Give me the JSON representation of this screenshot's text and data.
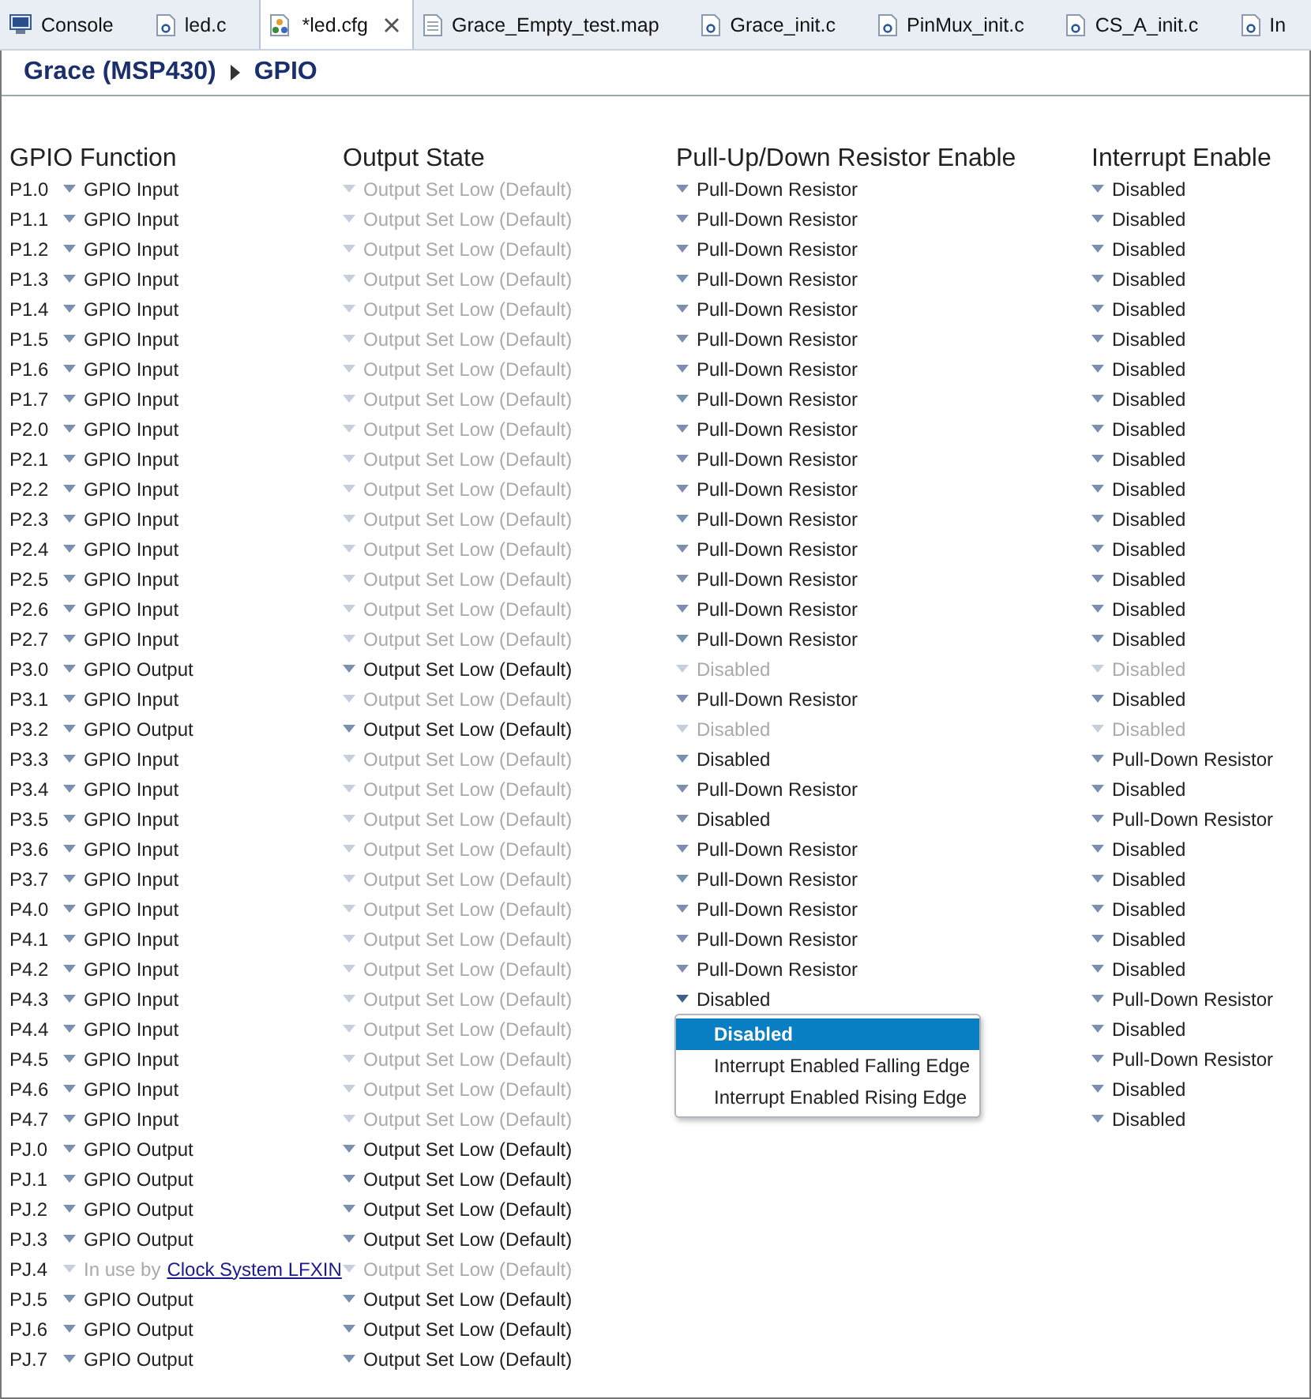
{
  "tabs": [
    {
      "label": "Console",
      "kind": "console",
      "selected": false,
      "closable": false
    },
    {
      "label": "led.c",
      "kind": "c",
      "selected": false,
      "closable": false
    },
    {
      "label": "*led.cfg",
      "kind": "cfg",
      "selected": true,
      "closable": true
    },
    {
      "label": "Grace_Empty_test.map",
      "kind": "file",
      "selected": false,
      "closable": false
    },
    {
      "label": "Grace_init.c",
      "kind": "c",
      "selected": false,
      "closable": false
    },
    {
      "label": "PinMux_init.c",
      "kind": "c",
      "selected": false,
      "closable": false
    },
    {
      "label": "CS_A_init.c",
      "kind": "c",
      "selected": false,
      "closable": false
    },
    {
      "label": "In",
      "kind": "c",
      "selected": false,
      "closable": false
    }
  ],
  "breadcrumb": [
    "Grace (MSP430)",
    "GPIO"
  ],
  "columns": [
    "GPIO Function",
    "Output State",
    "Pull-Up/Down Resistor Enable",
    "Interrupt Enable"
  ],
  "rows": [
    {
      "pin": "P1.0",
      "function": {
        "text": "GPIO Input",
        "disabled": false
      },
      "output": {
        "text": "Output Set Low (Default)",
        "disabled": true
      },
      "pull": {
        "text": "Pull-Down Resistor",
        "disabled": false
      },
      "interrupt": {
        "text": "Disabled",
        "disabled": false
      }
    },
    {
      "pin": "P1.1",
      "function": {
        "text": "GPIO Input",
        "disabled": false
      },
      "output": {
        "text": "Output Set Low (Default)",
        "disabled": true
      },
      "pull": {
        "text": "Pull-Down Resistor",
        "disabled": false
      },
      "interrupt": {
        "text": "Disabled",
        "disabled": false
      }
    },
    {
      "pin": "P1.2",
      "function": {
        "text": "GPIO Input",
        "disabled": false
      },
      "output": {
        "text": "Output Set Low (Default)",
        "disabled": true
      },
      "pull": {
        "text": "Pull-Down Resistor",
        "disabled": false
      },
      "interrupt": {
        "text": "Disabled",
        "disabled": false
      }
    },
    {
      "pin": "P1.3",
      "function": {
        "text": "GPIO Input",
        "disabled": false
      },
      "output": {
        "text": "Output Set Low (Default)",
        "disabled": true
      },
      "pull": {
        "text": "Pull-Down Resistor",
        "disabled": false
      },
      "interrupt": {
        "text": "Disabled",
        "disabled": false
      }
    },
    {
      "pin": "P1.4",
      "function": {
        "text": "GPIO Input",
        "disabled": false
      },
      "output": {
        "text": "Output Set Low (Default)",
        "disabled": true
      },
      "pull": {
        "text": "Pull-Down Resistor",
        "disabled": false
      },
      "interrupt": {
        "text": "Disabled",
        "disabled": false
      }
    },
    {
      "pin": "P1.5",
      "function": {
        "text": "GPIO Input",
        "disabled": false
      },
      "output": {
        "text": "Output Set Low (Default)",
        "disabled": true
      },
      "pull": {
        "text": "Pull-Down Resistor",
        "disabled": false
      },
      "interrupt": {
        "text": "Disabled",
        "disabled": false
      }
    },
    {
      "pin": "P1.6",
      "function": {
        "text": "GPIO Input",
        "disabled": false
      },
      "output": {
        "text": "Output Set Low (Default)",
        "disabled": true
      },
      "pull": {
        "text": "Pull-Down Resistor",
        "disabled": false
      },
      "interrupt": {
        "text": "Disabled",
        "disabled": false
      }
    },
    {
      "pin": "P1.7",
      "function": {
        "text": "GPIO Input",
        "disabled": false
      },
      "output": {
        "text": "Output Set Low (Default)",
        "disabled": true
      },
      "pull": {
        "text": "Pull-Down Resistor",
        "disabled": false
      },
      "interrupt": {
        "text": "Disabled",
        "disabled": false
      }
    },
    {
      "pin": "P2.0",
      "function": {
        "text": "GPIO Input",
        "disabled": false
      },
      "output": {
        "text": "Output Set Low (Default)",
        "disabled": true
      },
      "pull": {
        "text": "Pull-Down Resistor",
        "disabled": false
      },
      "interrupt": {
        "text": "Disabled",
        "disabled": false
      }
    },
    {
      "pin": "P2.1",
      "function": {
        "text": "GPIO Input",
        "disabled": false
      },
      "output": {
        "text": "Output Set Low (Default)",
        "disabled": true
      },
      "pull": {
        "text": "Pull-Down Resistor",
        "disabled": false
      },
      "interrupt": {
        "text": "Disabled",
        "disabled": false
      }
    },
    {
      "pin": "P2.2",
      "function": {
        "text": "GPIO Input",
        "disabled": false
      },
      "output": {
        "text": "Output Set Low (Default)",
        "disabled": true
      },
      "pull": {
        "text": "Pull-Down Resistor",
        "disabled": false
      },
      "interrupt": {
        "text": "Disabled",
        "disabled": false
      }
    },
    {
      "pin": "P2.3",
      "function": {
        "text": "GPIO Input",
        "disabled": false
      },
      "output": {
        "text": "Output Set Low (Default)",
        "disabled": true
      },
      "pull": {
        "text": "Pull-Down Resistor",
        "disabled": false
      },
      "interrupt": {
        "text": "Disabled",
        "disabled": false
      }
    },
    {
      "pin": "P2.4",
      "function": {
        "text": "GPIO Input",
        "disabled": false
      },
      "output": {
        "text": "Output Set Low (Default)",
        "disabled": true
      },
      "pull": {
        "text": "Pull-Down Resistor",
        "disabled": false
      },
      "interrupt": {
        "text": "Disabled",
        "disabled": false
      }
    },
    {
      "pin": "P2.5",
      "function": {
        "text": "GPIO Input",
        "disabled": false
      },
      "output": {
        "text": "Output Set Low (Default)",
        "disabled": true
      },
      "pull": {
        "text": "Pull-Down Resistor",
        "disabled": false
      },
      "interrupt": {
        "text": "Disabled",
        "disabled": false
      }
    },
    {
      "pin": "P2.6",
      "function": {
        "text": "GPIO Input",
        "disabled": false
      },
      "output": {
        "text": "Output Set Low (Default)",
        "disabled": true
      },
      "pull": {
        "text": "Pull-Down Resistor",
        "disabled": false
      },
      "interrupt": {
        "text": "Disabled",
        "disabled": false
      }
    },
    {
      "pin": "P2.7",
      "function": {
        "text": "GPIO Input",
        "disabled": false
      },
      "output": {
        "text": "Output Set Low (Default)",
        "disabled": true
      },
      "pull": {
        "text": "Pull-Down Resistor",
        "disabled": false
      },
      "interrupt": {
        "text": "Disabled",
        "disabled": false
      }
    },
    {
      "pin": "P3.0",
      "function": {
        "text": "GPIO Output",
        "disabled": false
      },
      "output": {
        "text": "Output Set Low (Default)",
        "disabled": false
      },
      "pull": {
        "text": "Disabled",
        "disabled": true
      },
      "interrupt": {
        "text": "Disabled",
        "disabled": true
      }
    },
    {
      "pin": "P3.1",
      "function": {
        "text": "GPIO Input",
        "disabled": false
      },
      "output": {
        "text": "Output Set Low (Default)",
        "disabled": true
      },
      "pull": {
        "text": "Pull-Down Resistor",
        "disabled": false
      },
      "interrupt": {
        "text": "Disabled",
        "disabled": false
      }
    },
    {
      "pin": "P3.2",
      "function": {
        "text": "GPIO Output",
        "disabled": false
      },
      "output": {
        "text": "Output Set Low (Default)",
        "disabled": false
      },
      "pull": {
        "text": "Disabled",
        "disabled": true
      },
      "interrupt": {
        "text": "Disabled",
        "disabled": true
      }
    },
    {
      "pin": "P3.3",
      "function": {
        "text": "GPIO Input",
        "disabled": false
      },
      "output": {
        "text": "Output Set Low (Default)",
        "disabled": true
      },
      "pull": {
        "text": "Disabled",
        "disabled": false
      },
      "interrupt": {
        "text": "Pull-Down Resistor",
        "disabled": false
      }
    },
    {
      "pin": "P3.4",
      "function": {
        "text": "GPIO Input",
        "disabled": false
      },
      "output": {
        "text": "Output Set Low (Default)",
        "disabled": true
      },
      "pull": {
        "text": "Pull-Down Resistor",
        "disabled": false
      },
      "interrupt": {
        "text": "Disabled",
        "disabled": false
      }
    },
    {
      "pin": "P3.5",
      "function": {
        "text": "GPIO Input",
        "disabled": false
      },
      "output": {
        "text": "Output Set Low (Default)",
        "disabled": true
      },
      "pull": {
        "text": "Disabled",
        "disabled": false
      },
      "interrupt": {
        "text": "Pull-Down Resistor",
        "disabled": false
      }
    },
    {
      "pin": "P3.6",
      "function": {
        "text": "GPIO Input",
        "disabled": false
      },
      "output": {
        "text": "Output Set Low (Default)",
        "disabled": true
      },
      "pull": {
        "text": "Pull-Down Resistor",
        "disabled": false
      },
      "interrupt": {
        "text": "Disabled",
        "disabled": false
      }
    },
    {
      "pin": "P3.7",
      "function": {
        "text": "GPIO Input",
        "disabled": false
      },
      "output": {
        "text": "Output Set Low (Default)",
        "disabled": true
      },
      "pull": {
        "text": "Pull-Down Resistor",
        "disabled": false
      },
      "interrupt": {
        "text": "Disabled",
        "disabled": false
      }
    },
    {
      "pin": "P4.0",
      "function": {
        "text": "GPIO Input",
        "disabled": false
      },
      "output": {
        "text": "Output Set Low (Default)",
        "disabled": true
      },
      "pull": {
        "text": "Pull-Down Resistor",
        "disabled": false
      },
      "interrupt": {
        "text": "Disabled",
        "disabled": false
      }
    },
    {
      "pin": "P4.1",
      "function": {
        "text": "GPIO Input",
        "disabled": false
      },
      "output": {
        "text": "Output Set Low (Default)",
        "disabled": true
      },
      "pull": {
        "text": "Pull-Down Resistor",
        "disabled": false
      },
      "interrupt": {
        "text": "Disabled",
        "disabled": false
      }
    },
    {
      "pin": "P4.2",
      "function": {
        "text": "GPIO Input",
        "disabled": false
      },
      "output": {
        "text": "Output Set Low (Default)",
        "disabled": true
      },
      "pull": {
        "text": "Pull-Down Resistor",
        "disabled": false
      },
      "interrupt": {
        "text": "Disabled",
        "disabled": false
      }
    },
    {
      "pin": "P4.3",
      "function": {
        "text": "GPIO Input",
        "disabled": false
      },
      "output": {
        "text": "Output Set Low (Default)",
        "disabled": true
      },
      "pull": {
        "text": "Disabled",
        "disabled": false,
        "open": true,
        "options": [
          {
            "label": "Disabled",
            "selected": true
          },
          {
            "label": "Interrupt Enabled Falling Edge",
            "selected": false
          },
          {
            "label": "Interrupt Enabled Rising Edge",
            "selected": false
          }
        ]
      },
      "interrupt": {
        "text": "Pull-Down Resistor",
        "disabled": false
      }
    },
    {
      "pin": "P4.4",
      "function": {
        "text": "GPIO Input",
        "disabled": false
      },
      "output": {
        "text": "Output Set Low (Default)",
        "disabled": true
      },
      "interrupt": {
        "text": "Disabled",
        "disabled": false
      }
    },
    {
      "pin": "P4.5",
      "function": {
        "text": "GPIO Input",
        "disabled": false
      },
      "output": {
        "text": "Output Set Low (Default)",
        "disabled": true
      },
      "interrupt": {
        "text": "Pull-Down Resistor",
        "disabled": false
      }
    },
    {
      "pin": "P4.6",
      "function": {
        "text": "GPIO Input",
        "disabled": false
      },
      "output": {
        "text": "Output Set Low (Default)",
        "disabled": true
      },
      "interrupt": {
        "text": "Disabled",
        "disabled": false
      }
    },
    {
      "pin": "P4.7",
      "function": {
        "text": "GPIO Input",
        "disabled": false
      },
      "output": {
        "text": "Output Set Low (Default)",
        "disabled": true
      },
      "interrupt": {
        "text": "Disabled",
        "disabled": false
      }
    },
    {
      "pin": "PJ.0",
      "function": {
        "text": "GPIO Output",
        "disabled": false
      },
      "output": {
        "text": "Output Set Low (Default)",
        "disabled": false
      }
    },
    {
      "pin": "PJ.1",
      "function": {
        "text": "GPIO Output",
        "disabled": false
      },
      "output": {
        "text": "Output Set Low (Default)",
        "disabled": false
      }
    },
    {
      "pin": "PJ.2",
      "function": {
        "text": "GPIO Output",
        "disabled": false
      },
      "output": {
        "text": "Output Set Low (Default)",
        "disabled": false
      }
    },
    {
      "pin": "PJ.3",
      "function": {
        "text": "GPIO Output",
        "disabled": false
      },
      "output": {
        "text": "Output Set Low (Default)",
        "disabled": false
      }
    },
    {
      "pin": "PJ.4",
      "function": {
        "text": "In use by",
        "link": "Clock System LFXIN",
        "disabled": true
      },
      "output": {
        "text": "Output Set Low (Default)",
        "disabled": true
      }
    },
    {
      "pin": "PJ.5",
      "function": {
        "text": "GPIO Output",
        "disabled": false
      },
      "output": {
        "text": "Output Set Low (Default)",
        "disabled": false
      }
    },
    {
      "pin": "PJ.6",
      "function": {
        "text": "GPIO Output",
        "disabled": false
      },
      "output": {
        "text": "Output Set Low (Default)",
        "disabled": false
      }
    },
    {
      "pin": "PJ.7",
      "function": {
        "text": "GPIO Output",
        "disabled": false
      },
      "output": {
        "text": "Output Set Low (Default)",
        "disabled": false
      }
    }
  ]
}
